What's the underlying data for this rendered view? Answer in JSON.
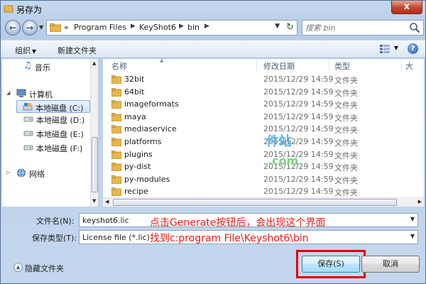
{
  "window": {
    "title": "另存为",
    "close_label": "x"
  },
  "address_bar": {
    "crumbs": [
      "Program Files",
      "KeyShot6",
      "bin"
    ],
    "prefix": "«"
  },
  "search": {
    "placeholder": "搜索 bin"
  },
  "toolbar": {
    "organize": "组织",
    "new_folder": "新建文件夹"
  },
  "nav_pane": {
    "items": [
      {
        "label": "音乐",
        "icon": "music-note-icon"
      },
      {
        "label": "计算机",
        "icon": "computer-icon"
      },
      {
        "label": "本地磁盘 (C:)",
        "icon": "drive-icon",
        "selected": true
      },
      {
        "label": "本地磁盘 (D:)",
        "icon": "drive-icon"
      },
      {
        "label": "本地磁盘 (E:)",
        "icon": "drive-icon"
      },
      {
        "label": "本地磁盘 (F:)",
        "icon": "drive-icon"
      },
      {
        "label": "网络",
        "icon": "network-icon"
      }
    ]
  },
  "file_list": {
    "columns": {
      "name": "名称",
      "date": "修改日期",
      "type": "类型",
      "extra": "大"
    },
    "rows": [
      {
        "name": "32bit",
        "date": "2015/12/29 14:59",
        "type": "文件夹"
      },
      {
        "name": "64bit",
        "date": "2015/12/29 14:59",
        "type": "文件夹"
      },
      {
        "name": "imageformats",
        "date": "2015/12/29 14:59",
        "type": "文件夹"
      },
      {
        "name": "maya",
        "date": "2015/12/29 14:59",
        "type": "文件夹"
      },
      {
        "name": "mediaservice",
        "date": "2015/12/29 14:59",
        "type": "文件夹"
      },
      {
        "name": "platforms",
        "date": "2015/12/29 14:59",
        "type": "文件夹"
      },
      {
        "name": "plugins",
        "date": "2015/12/29 14:59",
        "type": "文件夹"
      },
      {
        "name": "py-dist",
        "date": "2015/12/29 14:59",
        "type": "文件夹"
      },
      {
        "name": "py-modules",
        "date": "2015/12/29 14:59",
        "type": "文件夹"
      },
      {
        "name": "recipe",
        "date": "2015/12/29 14:59",
        "type": "文件夹"
      }
    ]
  },
  "watermark": {
    "text": "件站",
    "sub": ".com"
  },
  "file_name": {
    "label": "文件名(N):",
    "value": "keyshot6.lic"
  },
  "file_type": {
    "label": "保存类型(T):",
    "value": "License file (*.lic)"
  },
  "annotations": {
    "line1": "点击Generate按钮后，会出现这个界面",
    "line2": "找到c:program File\\Keyshot6\\bin"
  },
  "footer": {
    "hide_folders": "隐藏文件夹",
    "save": "保存(S)",
    "cancel": "取消"
  },
  "colors": {
    "annotation": "#e81a1a",
    "highlight_frame": "#e10000",
    "folder": "#e8b64a"
  }
}
